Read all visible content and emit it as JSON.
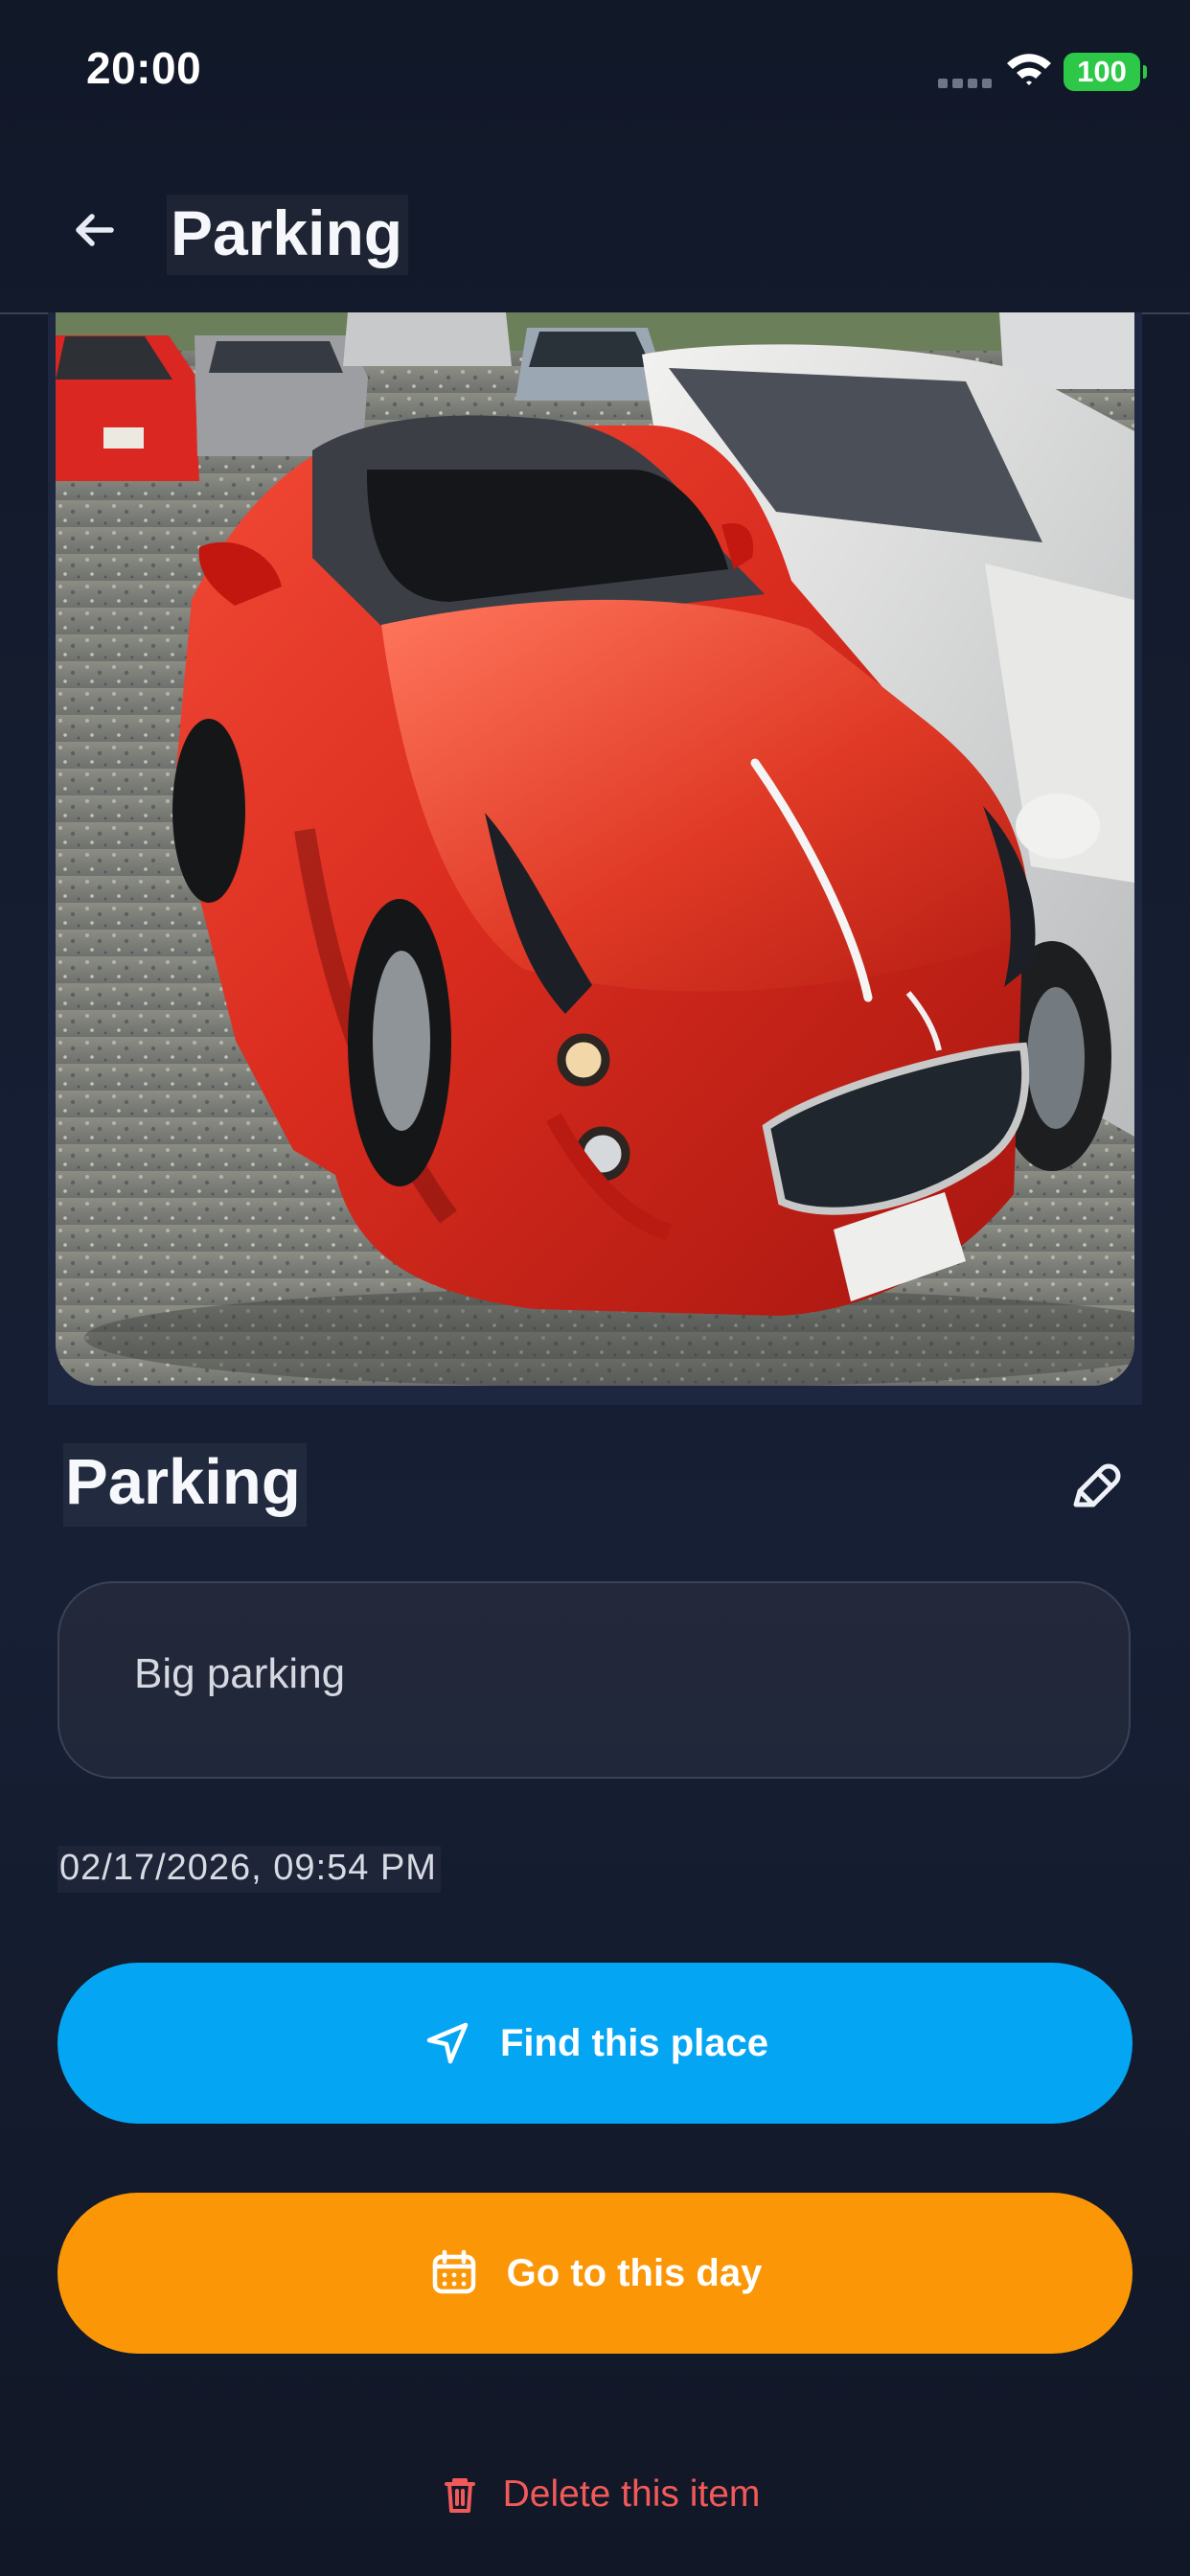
{
  "status_bar": {
    "time": "20:00",
    "battery": "100",
    "icons": [
      "signal-dots-icon",
      "wifi-icon",
      "battery-icon"
    ]
  },
  "header": {
    "title": "Parking",
    "back_icon": "arrow-left-icon"
  },
  "photo": {
    "subject": "red sports car in parking lot"
  },
  "item": {
    "title": "Parking",
    "edit_icon": "pencil-icon",
    "description": "Big parking",
    "timestamp": "02/17/2026, 09:54 PM"
  },
  "actions": {
    "find": {
      "label": "Find this place",
      "icon": "navigation-arrow-icon",
      "color": "#04a6f3"
    },
    "goto_day": {
      "label": "Go to this day",
      "icon": "calendar-icon",
      "color": "#fb9707"
    },
    "delete": {
      "label": "Delete this item",
      "icon": "trash-icon",
      "color": "#f25a5a"
    }
  },
  "theme": {
    "background": "#121a2b",
    "card": "#22283a",
    "text": "#f4f6fb"
  }
}
